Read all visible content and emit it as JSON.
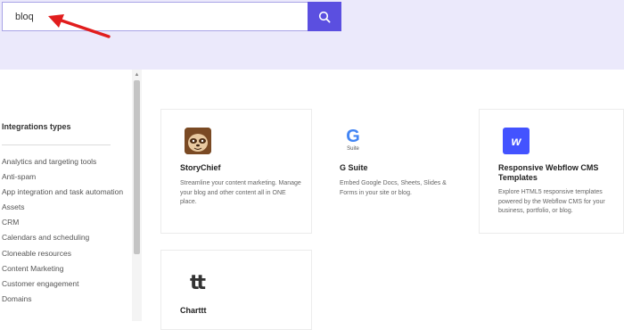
{
  "search": {
    "value": "bloq",
    "placeholder": "",
    "button_icon": "search-icon"
  },
  "annotation": {
    "icon": "red-arrow-icon",
    "color": "#e11d1d"
  },
  "sidebar": {
    "title": "Integrations types",
    "items": [
      {
        "label": "Analytics and targeting tools"
      },
      {
        "label": "Anti-spam"
      },
      {
        "label": "App integration and task automation"
      },
      {
        "label": "Assets"
      },
      {
        "label": "CRM"
      },
      {
        "label": "Calendars and scheduling"
      },
      {
        "label": "Cloneable resources"
      },
      {
        "label": "Content Marketing"
      },
      {
        "label": "Customer engagement"
      },
      {
        "label": "Domains"
      }
    ]
  },
  "cards": [
    {
      "name": "StoryChief",
      "description": "Streamline your content marketing. Manage your blog and other content all in ONE place.",
      "icon": "storychief-logo-icon"
    },
    {
      "name": "G Suite",
      "description": "Embed Google Docs, Sheets, Slides & Forms in your site or blog.",
      "icon": "gsuite-logo-icon",
      "logo_letter": "G",
      "logo_caption": "Suite"
    },
    {
      "name": "Responsive Webflow CMS Templates",
      "description": "Explore HTML5 responsive templates powered by the Webflow CMS for your business, portfolio, or blog.",
      "icon": "webflow-logo-icon",
      "logo_letter": "w"
    },
    {
      "name": "Charttt",
      "description": "",
      "icon": "charttt-logo-icon",
      "logo_letter": "tt"
    }
  ],
  "colors": {
    "accent": "#5b4fe0",
    "hero_bg": "#ebe9fb",
    "webflow": "#4353ff"
  }
}
